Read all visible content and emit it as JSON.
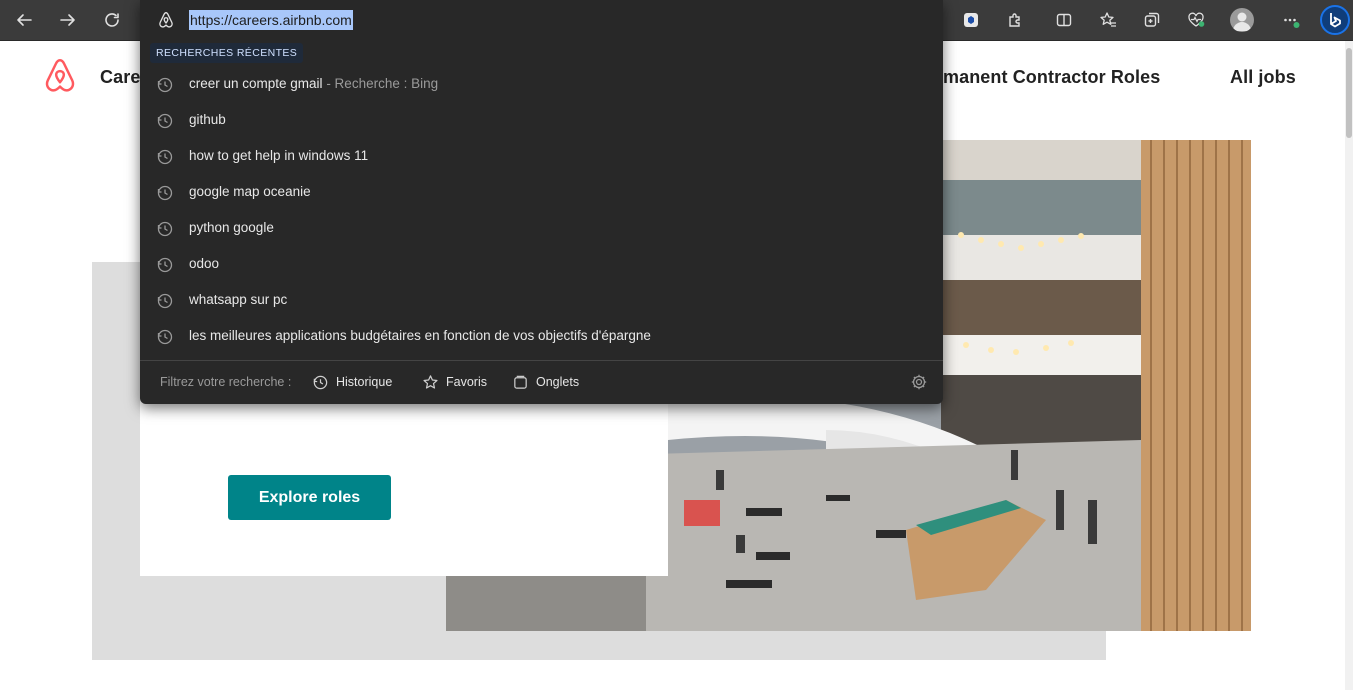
{
  "browser": {
    "address": "https://careers.airbnb.com",
    "icons": [
      "back-icon",
      "forward-icon",
      "refresh-icon",
      "extension-icon",
      "puzzle-icon",
      "split-screen-icon",
      "favorites-icon",
      "collections-icon",
      "performance-icon",
      "profile-icon",
      "more-icon",
      "bing-icon"
    ]
  },
  "dropdown": {
    "section_title": "RECHERCHES RÉCENTES",
    "suggestions": [
      {
        "text": "creer un compte gmail",
        "suffix": " - Recherche : Bing"
      },
      {
        "text": "github",
        "suffix": ""
      },
      {
        "text": "how to get help in windows 11",
        "suffix": ""
      },
      {
        "text": "google map oceanie",
        "suffix": ""
      },
      {
        "text": "python google",
        "suffix": ""
      },
      {
        "text": "odoo",
        "suffix": ""
      },
      {
        "text": "whatsapp sur pc",
        "suffix": ""
      },
      {
        "text": "les meilleures applications budgétaires en fonction de vos objectifs d'épargne",
        "suffix": ""
      }
    ],
    "filter_label": "Filtrez votre recherche :",
    "filters": [
      {
        "label": "Historique",
        "icon": "history-icon"
      },
      {
        "label": "Favoris",
        "icon": "star-icon"
      },
      {
        "label": "Onglets",
        "icon": "tabs-icon"
      }
    ]
  },
  "page": {
    "nav_left": "Care",
    "nav_middle": "manent Contractor Roles",
    "nav_right": "All jobs",
    "cta": "Explore roles",
    "colors": {
      "cta": "#008489",
      "logo": "#FF5A5F"
    }
  }
}
